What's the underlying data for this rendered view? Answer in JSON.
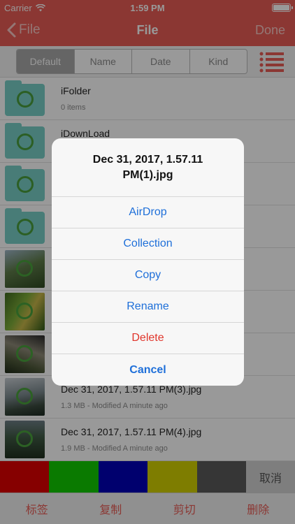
{
  "status_bar": {
    "carrier": "Carrier",
    "time": "1:59 PM"
  },
  "nav": {
    "back_label": "File",
    "title": "File",
    "done_label": "Done"
  },
  "sort": {
    "segments": [
      "Default",
      "Name",
      "Date",
      "Kind"
    ],
    "selected": "Default"
  },
  "files": [
    {
      "name": "iFolder",
      "meta": "0  items",
      "kind": "folder"
    },
    {
      "name": "iDownLoad",
      "meta": "",
      "kind": "folder"
    },
    {
      "name": "",
      "meta": "",
      "kind": "folder"
    },
    {
      "name": "",
      "meta": "",
      "kind": "folder"
    },
    {
      "name": "",
      "meta": "",
      "kind": "photo"
    },
    {
      "name": "",
      "meta": "",
      "kind": "photo"
    },
    {
      "name": "",
      "meta": "",
      "kind": "photo"
    },
    {
      "name": "Dec 31, 2017, 1.57.11 PM(3).jpg",
      "meta": "1.3 MB - Modified A minute ago",
      "kind": "photo"
    },
    {
      "name": "Dec 31, 2017, 1.57.11 PM(4).jpg",
      "meta": "1.9 MB - Modified A minute ago",
      "kind": "photo"
    }
  ],
  "colors": {
    "accent": "#e85c55",
    "link": "#1e6fd9",
    "destructive": "#e0352b",
    "folder": "#79cfc7",
    "swatches": [
      "#e00000",
      "#11cc00",
      "#0000b8",
      "#d3d000",
      "#5a5a5a"
    ]
  },
  "color_bar": {
    "cancel_label": "取消"
  },
  "toolbar": {
    "tag_label": "标签",
    "copy_label": "复制",
    "cut_label": "剪切",
    "delete_label": "删除"
  },
  "action_sheet": {
    "title": "Dec 31, 2017, 1.57.11 PM(1).jpg",
    "airdrop_label": "AirDrop",
    "collection_label": "Collection",
    "copy_label": "Copy",
    "rename_label": "Rename",
    "delete_label": "Delete",
    "cancel_label": "Cancel"
  },
  "icons": {
    "back": "chevron-left-icon",
    "list_toggle": "list-icon",
    "wifi": "wifi-icon",
    "battery": "battery-icon",
    "folder": "folder-icon"
  }
}
